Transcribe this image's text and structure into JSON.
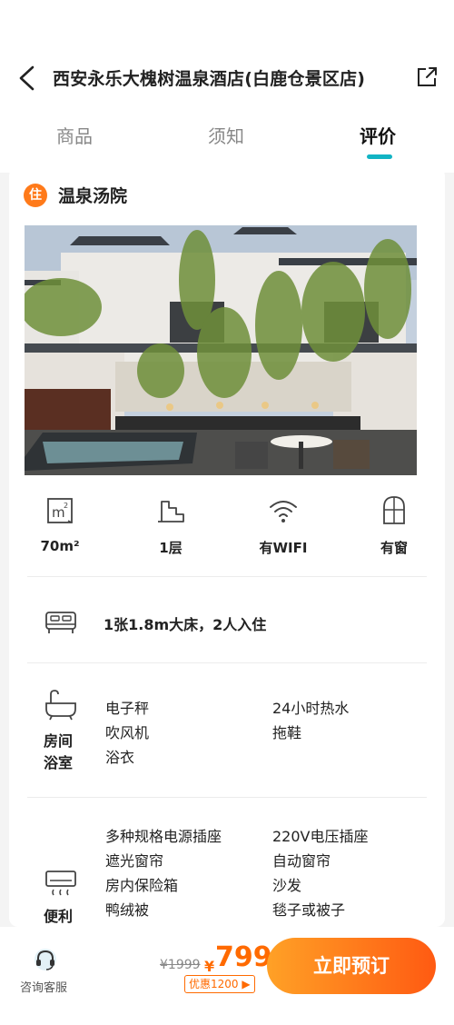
{
  "header": {
    "title": "西安永乐大槐树温泉酒店(白鹿仓景区店)",
    "tabs": [
      "商品",
      "须知",
      "评价"
    ],
    "active_tab": "评价",
    "accent_color": "#12b4c4"
  },
  "room": {
    "badge": "住",
    "name": "温泉汤院",
    "facts": [
      {
        "icon": "area-icon",
        "label": "70m²"
      },
      {
        "icon": "floor-stairs-icon",
        "label": "1层"
      },
      {
        "icon": "wifi-icon",
        "label": "有WIFI"
      },
      {
        "icon": "window-icon",
        "label": "有窗"
      }
    ],
    "bed": "1张1.8m大床，2人入住",
    "bathroom": {
      "label": "房间浴室",
      "items": [
        "电子秤",
        "24小时热水",
        "吹风机",
        "拖鞋",
        "浴衣"
      ]
    },
    "convenience": {
      "label": "便利",
      "items": [
        "多种规格电源插座",
        "220V电压插座",
        "遮光窗帘",
        "自动窗帘",
        "房内保险箱",
        "沙发",
        "鸭绒被",
        "毯子或被子"
      ]
    }
  },
  "bottom": {
    "service_label": "咨询客服",
    "original_price": "¥1999",
    "currency": "¥",
    "price": "799",
    "discount": "优惠1200 ▶",
    "book_label": "立即预订",
    "brand_color": "#ff6a00"
  }
}
